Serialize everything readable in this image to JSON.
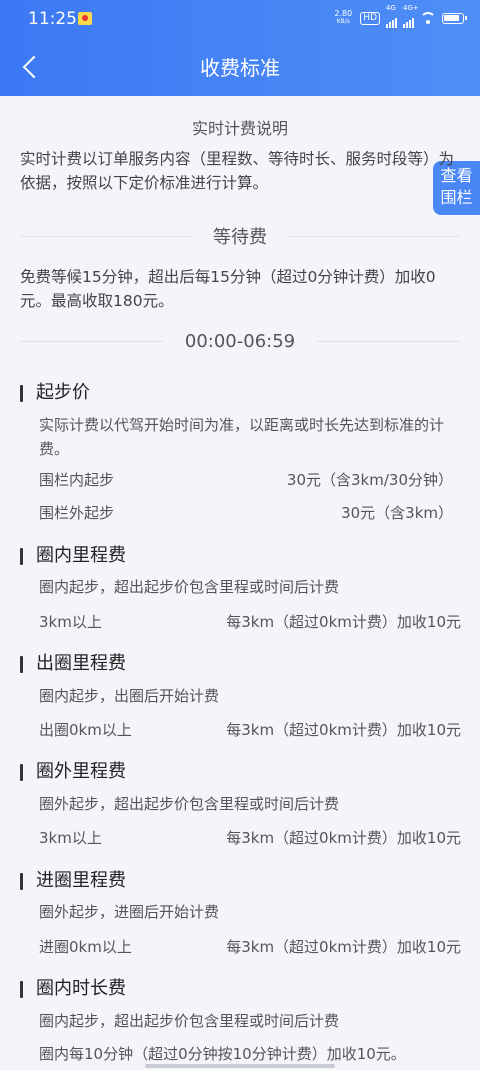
{
  "status": {
    "time": "11:25",
    "net_speed_value": "2.80",
    "net_speed_unit": "KB/s",
    "hd_badge": "HD",
    "signal1_label": "4G",
    "signal2_label": "4G+"
  },
  "header": {
    "title": "收费标准"
  },
  "float_button": {
    "line1": "查看",
    "line2": "围栏"
  },
  "realtime": {
    "title": "实时计费说明",
    "text": "实时计费以订单服务内容（里程数、等待时长、服务时段等）为依据，按照以下定价标准进行计算。"
  },
  "waiting": {
    "title": "等待费",
    "text": "免费等候15分钟，超出后每15分钟（超过0分钟计费）加收0元。最高收取180元。"
  },
  "period": {
    "label": "00:00-06:59"
  },
  "groups": {
    "start_price": {
      "title": "起步价",
      "desc": "实际计费以代驾开始时间为准，以距离或时长先达到标准的计费。",
      "rows": [
        {
          "label": "围栏内起步",
          "value": "30元（含3km/30分钟）"
        },
        {
          "label": "围栏外起步",
          "value": "30元（含3km）"
        }
      ]
    },
    "inner_mileage": {
      "title": "圈内里程费",
      "desc": "圈内起步，超出起步价包含里程或时间后计费",
      "row": {
        "label": "3km以上",
        "value": "每3km（超过0km计费）加收10元"
      }
    },
    "exit_mileage": {
      "title": "出圈里程费",
      "desc": "圈内起步，出圈后开始计费",
      "row": {
        "label": "出圈0km以上",
        "value": "每3km（超过0km计费）加收10元"
      }
    },
    "outer_mileage": {
      "title": "圈外里程费",
      "desc": "圈外起步，超出起步价包含里程或时间后计费",
      "row": {
        "label": "3km以上",
        "value": "每3km（超过0km计费）加收10元"
      }
    },
    "enter_mileage": {
      "title": "进圈里程费",
      "desc": "圈外起步，进圈后开始计费",
      "row": {
        "label": "进圈0km以上",
        "value": "每3km（超过0km计费）加收10元"
      }
    },
    "inner_duration": {
      "title": "圈内时长费",
      "desc": "圈内起步，超出起步价包含里程或时间后计费",
      "row": {
        "text": "圈内每10分钟（超过0分钟按10分钟计费）加收10元。"
      }
    }
  }
}
